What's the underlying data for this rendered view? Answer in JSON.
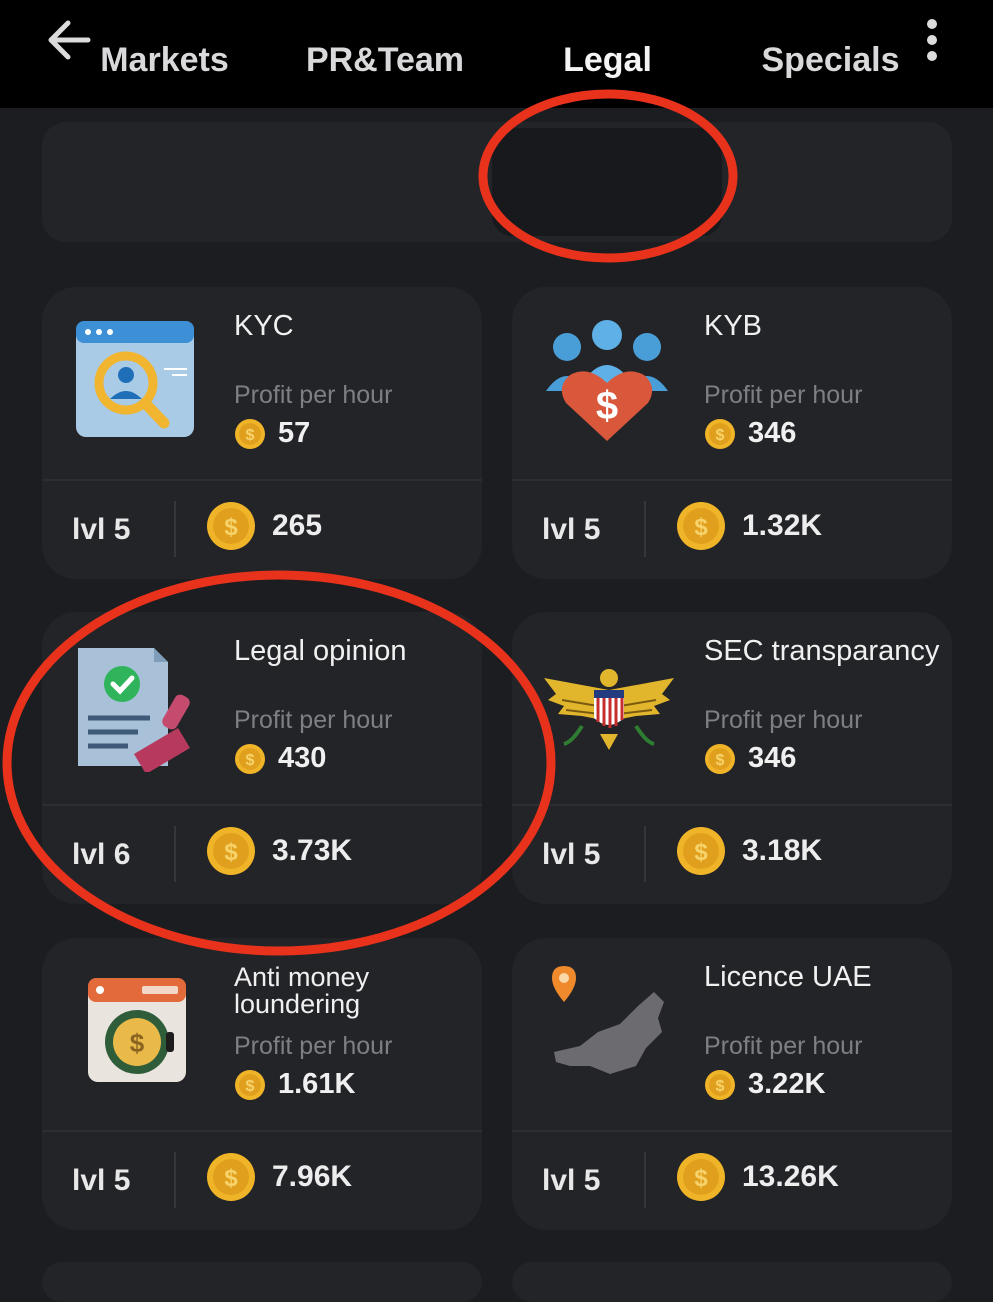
{
  "header": {
    "back_icon": "arrow-left-icon",
    "menu_icon": "more-vertical-icon"
  },
  "tabs": [
    {
      "label": "Markets",
      "active": false
    },
    {
      "label": "PR&Team",
      "active": false
    },
    {
      "label": "Legal",
      "active": true
    },
    {
      "label": "Specials",
      "active": false
    }
  ],
  "cards": [
    {
      "title": "KYC",
      "profit_label": "Profit per hour",
      "profit": "57",
      "level": "lvl 5",
      "cost": "265",
      "icon": "kyc-search-icon"
    },
    {
      "title": "KYB",
      "profit_label": "Profit per hour",
      "profit": "346",
      "level": "lvl 5",
      "cost": "1.32K",
      "icon": "kyb-team-icon"
    },
    {
      "title": "Legal opinion",
      "profit_label": "Profit per hour",
      "profit": "430",
      "level": "lvl 6",
      "cost": "3.73K",
      "icon": "legal-document-stamp-icon"
    },
    {
      "title": "SEC transparancy",
      "profit_label": "Profit per hour",
      "profit": "346",
      "level": "lvl 5",
      "cost": "3.18K",
      "icon": "eagle-seal-icon"
    },
    {
      "title": "Anti money loundering",
      "profit_label": "Profit per hour",
      "profit": "1.61K",
      "level": "lvl 5",
      "cost": "7.96K",
      "icon": "washing-machine-coin-icon"
    },
    {
      "title": "Licence UAE",
      "profit_label": "Profit per hour",
      "profit": "3.22K",
      "level": "lvl 5",
      "cost": "13.26K",
      "icon": "uae-map-pin-icon"
    }
  ],
  "colors": {
    "background": "#1c1d20",
    "card": "#232428",
    "coin": "#f0b429",
    "annotation": "#e8321c"
  }
}
